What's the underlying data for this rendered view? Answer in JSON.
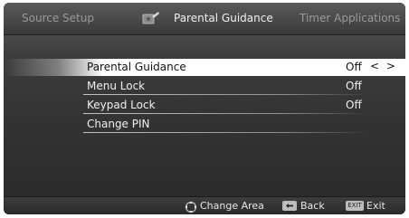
{
  "tabs": {
    "left": "Source Setup",
    "center": "Parental Guidance",
    "right": "Timer Applications",
    "center_icon": "parental-lock-icon"
  },
  "menu": {
    "items": [
      {
        "label": "Parental Guidance",
        "value": "Off",
        "selected": true,
        "arrows": "< >"
      },
      {
        "label": "Menu Lock",
        "value": "Off"
      },
      {
        "label": "Keypad Lock",
        "value": "Off"
      },
      {
        "label": "Change PIN",
        "value": ""
      }
    ]
  },
  "footer": {
    "change_area": "Change Area",
    "back": "Back",
    "exit_key": "EXIT",
    "exit": "Exit"
  }
}
